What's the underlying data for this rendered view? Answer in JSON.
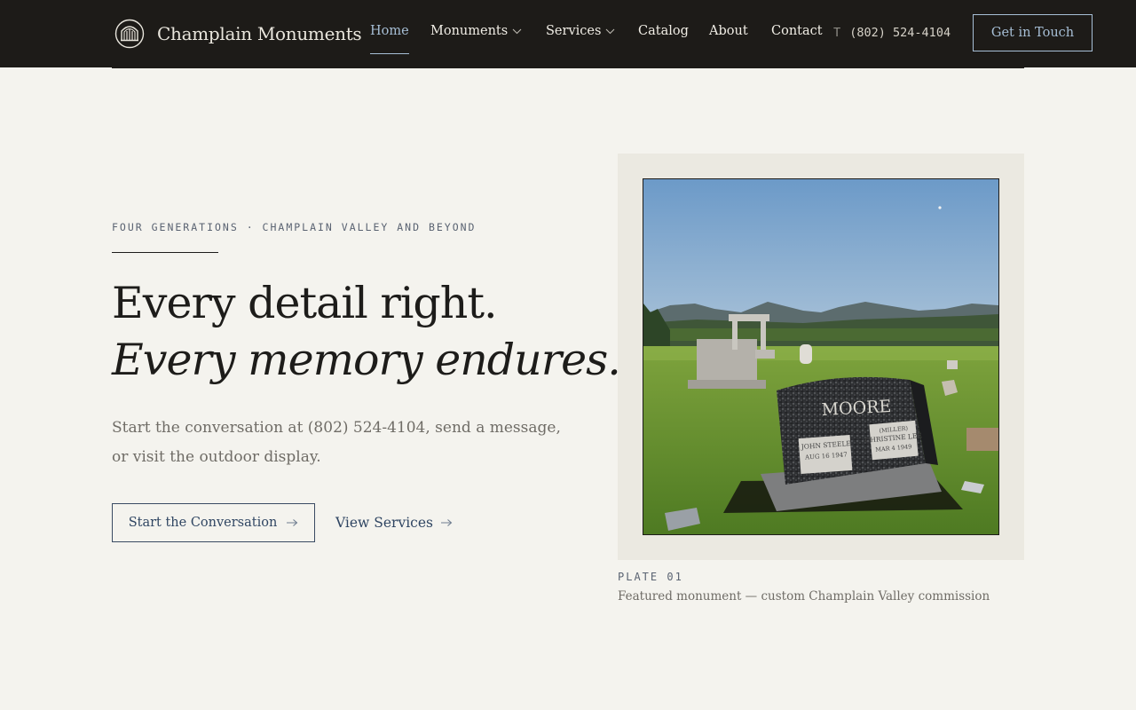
{
  "header": {
    "brand_name": "Champlain Monuments",
    "nav": [
      {
        "label": "Home",
        "active": true
      },
      {
        "label": "Monuments",
        "has_dropdown": true
      },
      {
        "label": "Services",
        "has_dropdown": true
      },
      {
        "label": "Catalog"
      },
      {
        "label": "About"
      },
      {
        "label": "Contact"
      }
    ],
    "phone_prefix": "T",
    "phone": "(802) 524-4104",
    "cta_label": "Get in Touch"
  },
  "hero": {
    "eyebrow": "FOUR GENERATIONS · CHAMPLAIN VALLEY AND BEYOND",
    "headline_line1": "Every detail right.",
    "headline_line2": "Every memory endures.",
    "lede": "Start the conversation at (802) 524-4104, send a message, or visit the outdoor display.",
    "primary_label": "Start the Conversation",
    "secondary_label": "View Services"
  },
  "plate": {
    "number": "PLATE 01",
    "caption": "Featured monument — custom Champlain Valley commission",
    "photo": {
      "family_name": "MOORE",
      "left_panel_line1": "JOHN STEELE",
      "left_panel_line2": "AUG 16 1947",
      "right_panel_line1": "(MILLER)",
      "right_panel_line2": "CHRISTINE LEE",
      "right_panel_line3": "MAR 4 1949"
    }
  },
  "colors": {
    "header_bg": "#1d1b18",
    "page_bg": "#f4f3ee",
    "accent": "#a7bfd6",
    "button_ink": "#2f4562"
  },
  "icons": {
    "brand": "arch-columns-icon",
    "dropdown": "chevron-down-icon",
    "cta": "arrow-right-icon"
  }
}
